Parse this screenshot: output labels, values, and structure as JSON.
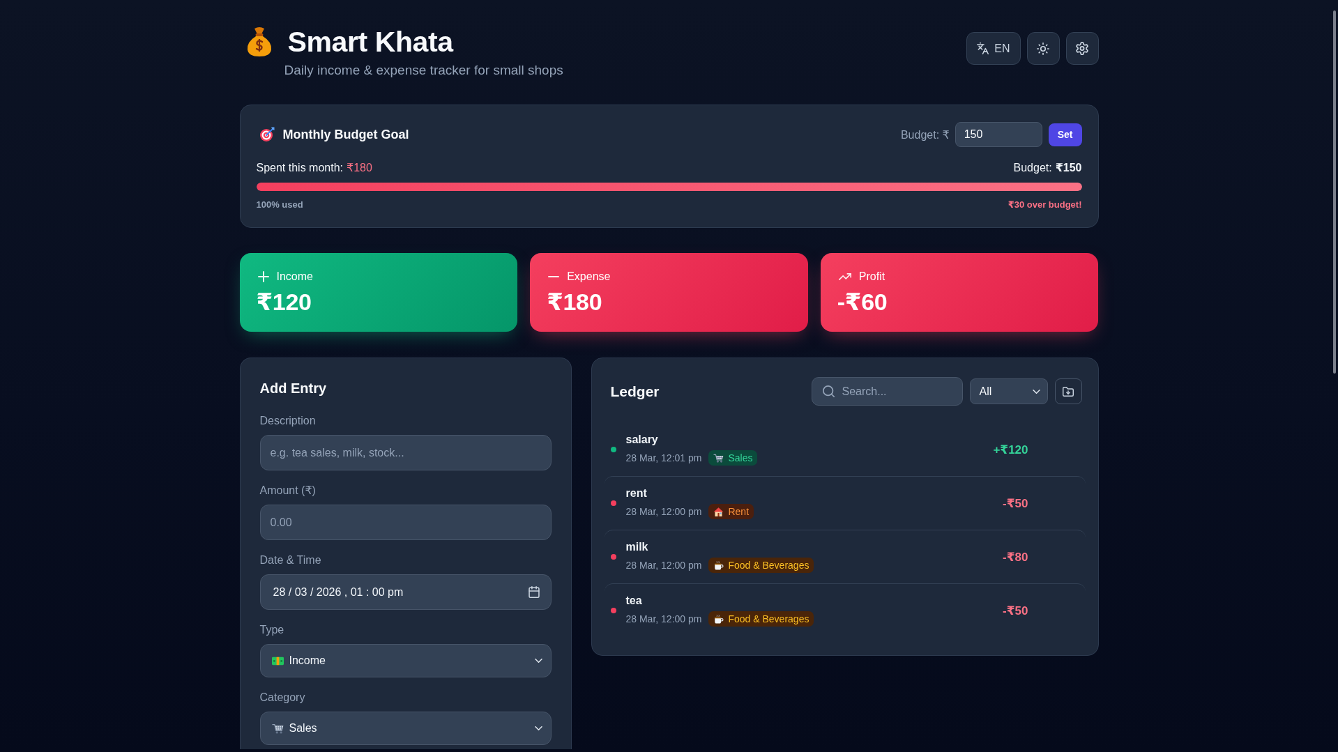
{
  "app": {
    "title": "Smart Khata",
    "subtitle": "Daily income & expense tracker for small shops"
  },
  "toolbar": [
    {
      "kind": "language",
      "label": "EN"
    },
    {
      "kind": "theme"
    },
    {
      "kind": "settings"
    }
  ],
  "budget": {
    "title": "Monthly Budget Goal",
    "input_label": "Budget: ₹",
    "input_value": "150",
    "button": "Set",
    "spent_label": "Spent this month:",
    "spent_value": "₹180",
    "budget_label": "Budget:",
    "budget_value": "₹150",
    "level": 1,
    "usage": "100% used",
    "status": "₹30 over budget!",
    "over_budget": true
  },
  "stats": [
    {
      "kind": "income",
      "label": "Income",
      "value": "₹120",
      "positive": true
    },
    {
      "kind": "expense",
      "label": "Expense",
      "value": "₹180",
      "positive": false
    },
    {
      "kind": "profit",
      "label": "Profit",
      "value": "-₹60",
      "positive": false
    }
  ],
  "add_entry": {
    "title": "Add Entry",
    "fields": [
      {
        "kind": "text",
        "label": "Description",
        "placeholder": "e.g. tea sales, milk, stock..."
      },
      {
        "kind": "number",
        "label": "Amount (₹)",
        "placeholder": "0.00"
      },
      {
        "kind": "datetime",
        "label": "Date & Time",
        "value": "28 / 03 / 2026 , 01 : 00 pm"
      },
      {
        "kind": "select",
        "label": "Type",
        "option": {
          "kind": "income",
          "label": "Income"
        }
      },
      {
        "kind": "select",
        "label": "Category",
        "option": {
          "kind": "sales",
          "label": "Sales"
        }
      }
    ]
  },
  "ledger": {
    "title": "Ledger",
    "search": {
      "placeholder": "Search..."
    },
    "filter": "All",
    "entries": [
      {
        "kind": "income",
        "name": "salary",
        "time": "28 Mar, 12:01 pm",
        "category": {
          "kind": "sales",
          "label": "Sales"
        },
        "amount": "+₹120"
      },
      {
        "kind": "expense",
        "name": "rent",
        "time": "28 Mar, 12:00 pm",
        "category": {
          "kind": "rent",
          "label": "Rent"
        },
        "amount": "-₹50"
      },
      {
        "kind": "expense",
        "name": "milk",
        "time": "28 Mar, 12:00 pm",
        "category": {
          "kind": "food",
          "label": "Food & Beverages"
        },
        "amount": "-₹80"
      },
      {
        "kind": "expense",
        "name": "tea",
        "time": "28 Mar, 12:00 pm",
        "category": {
          "kind": "food",
          "label": "Food & Beverages"
        },
        "amount": "-₹50"
      }
    ]
  }
}
